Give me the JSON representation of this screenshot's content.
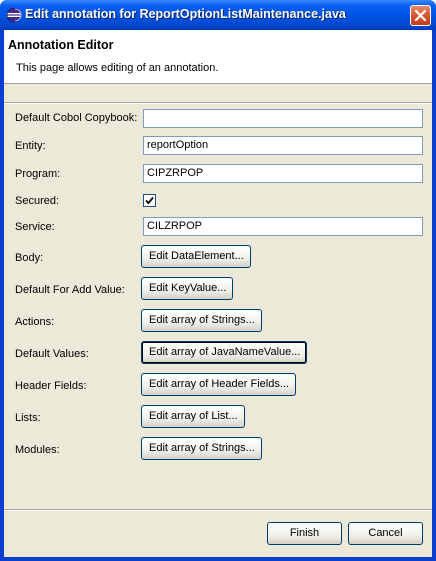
{
  "window": {
    "title": "Edit annotation for ReportOptionListMaintenance.java"
  },
  "banner": {
    "title": "Annotation Editor",
    "description": "This page allows editing of an annotation."
  },
  "fields": {
    "default_cobol_copybook": {
      "label": "Default Cobol Copybook:",
      "value": ""
    },
    "entity": {
      "label": "Entity:",
      "value": "reportOption"
    },
    "program": {
      "label": "Program:",
      "value": "CIPZRPOP"
    },
    "secured": {
      "label": "Secured:",
      "checked": true
    },
    "service": {
      "label": "Service:",
      "value": "CILZRPOP"
    },
    "body": {
      "label": "Body:",
      "button": "Edit DataElement..."
    },
    "default_for_add_value": {
      "label": "Default For Add Value:",
      "button": "Edit KeyValue..."
    },
    "actions": {
      "label": "Actions:",
      "button": "Edit array of Strings..."
    },
    "default_values": {
      "label": "Default Values:",
      "button": "Edit array of JavaNameValue..."
    },
    "header_fields": {
      "label": "Header Fields:",
      "button": "Edit array of Header Fields..."
    },
    "lists": {
      "label": "Lists:",
      "button": "Edit array of List..."
    },
    "modules": {
      "label": "Modules:",
      "button": "Edit array of Strings..."
    }
  },
  "footer": {
    "finish": "Finish",
    "cancel": "Cancel"
  },
  "icons": {
    "app": "eclipse-icon",
    "close": "close-icon",
    "check": "checkmark-icon"
  }
}
